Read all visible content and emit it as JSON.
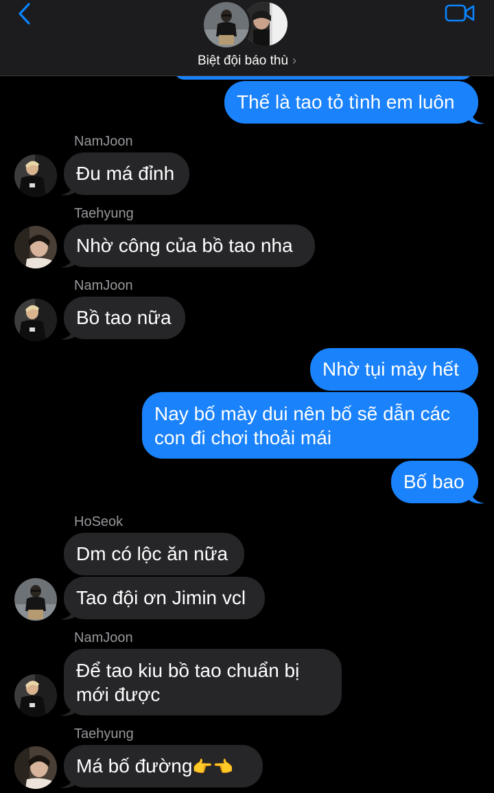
{
  "header": {
    "group_name": "Biệt đội báo thù",
    "chevron": "›"
  },
  "messages": [
    {
      "from": "me",
      "text": "Thế là tao tỏ tình em luôn"
    },
    {
      "from": "NamJoon",
      "sender_label": "NamJoon",
      "text": "Đu má đỉnh"
    },
    {
      "from": "Taehyung",
      "sender_label": "Taehyung",
      "text": "Nhờ công của bồ tao nha"
    },
    {
      "from": "NamJoon",
      "sender_label": "NamJoon",
      "text": "Bồ tao nữa"
    },
    {
      "from": "me",
      "text": "Nhờ tụi mày hết"
    },
    {
      "from": "me",
      "text_line1": "Nay bố mày dui nên bố sẽ dẫn các",
      "text_line2": "con đi chơi thoải mái"
    },
    {
      "from": "me",
      "text": "Bố bao"
    },
    {
      "from": "HoSeok",
      "sender_label": "HoSeok",
      "text": "Dm có lộc ăn nữa"
    },
    {
      "from": "HoSeok",
      "text": "Tao đội ơn Jimin vcl"
    },
    {
      "from": "NamJoon",
      "sender_label": "NamJoon",
      "text_line1": "Để tao kiu bồ tao chuẩn bị",
      "text_line2": "mới được"
    },
    {
      "from": "Taehyung",
      "sender_label": "Taehyung",
      "text": "Má bố đường",
      "emoji": "👉👈"
    }
  ],
  "colors": {
    "background": "#000000",
    "header_bg": "#1c1c1e",
    "outgoing_bubble": "#1a82fb",
    "incoming_bubble": "#262629",
    "accent": "#0a84ff",
    "sender_name": "#98989d"
  },
  "icons": {
    "back": "chevron-left-icon",
    "video": "video-camera-icon"
  }
}
